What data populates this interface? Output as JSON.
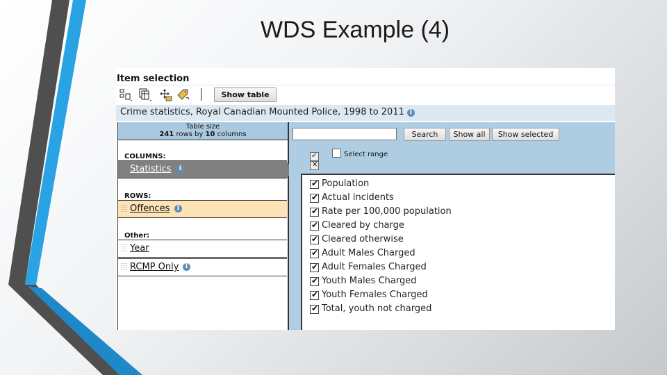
{
  "slide_title": "WDS Example (4)",
  "colors": {
    "left_bar_blue": "#29a3e3",
    "left_bar_gray": "#4a4a4a",
    "panel_blue": "#aecde3",
    "row_highlight": "#fde3b5"
  },
  "item_selection": {
    "heading": "Item selection",
    "toolbar_icons": [
      "layout-icon",
      "table-icon",
      "move-icon",
      "tag-edit-icon"
    ],
    "show_table_button": "Show table",
    "table_title": "Crime statistics, Royal Canadian Mounted Police, 1998 to 2011",
    "table_size": {
      "label": "Table size",
      "rows": "241",
      "rows_by": "rows by",
      "columns": "10",
      "columns_suffix": "columns"
    },
    "sections": {
      "columns": "COLUMNS:",
      "rows": "ROWS:",
      "other": "Other:"
    },
    "dimensions": {
      "statistics": "Statistics",
      "offences": "Offences",
      "year": "Year",
      "rcmp_only": "RCMP Only"
    }
  },
  "search": {
    "value": "",
    "search_button": "Search",
    "show_all_button": "Show all",
    "show_selected_button": "Show selected",
    "select_range_label": "Select range"
  },
  "statistics_items": [
    {
      "label": "Population",
      "checked": true
    },
    {
      "label": "Actual incidents",
      "checked": true
    },
    {
      "label": "Rate per 100,000 population",
      "checked": true
    },
    {
      "label": "Cleared by charge",
      "checked": true
    },
    {
      "label": "Cleared otherwise",
      "checked": true
    },
    {
      "label": "Adult Males Charged",
      "checked": true
    },
    {
      "label": "Adult Females Charged",
      "checked": true
    },
    {
      "label": "Youth Males Charged",
      "checked": true
    },
    {
      "label": "Youth Females Charged",
      "checked": true
    },
    {
      "label": "Total, youth not charged",
      "checked": true
    }
  ]
}
